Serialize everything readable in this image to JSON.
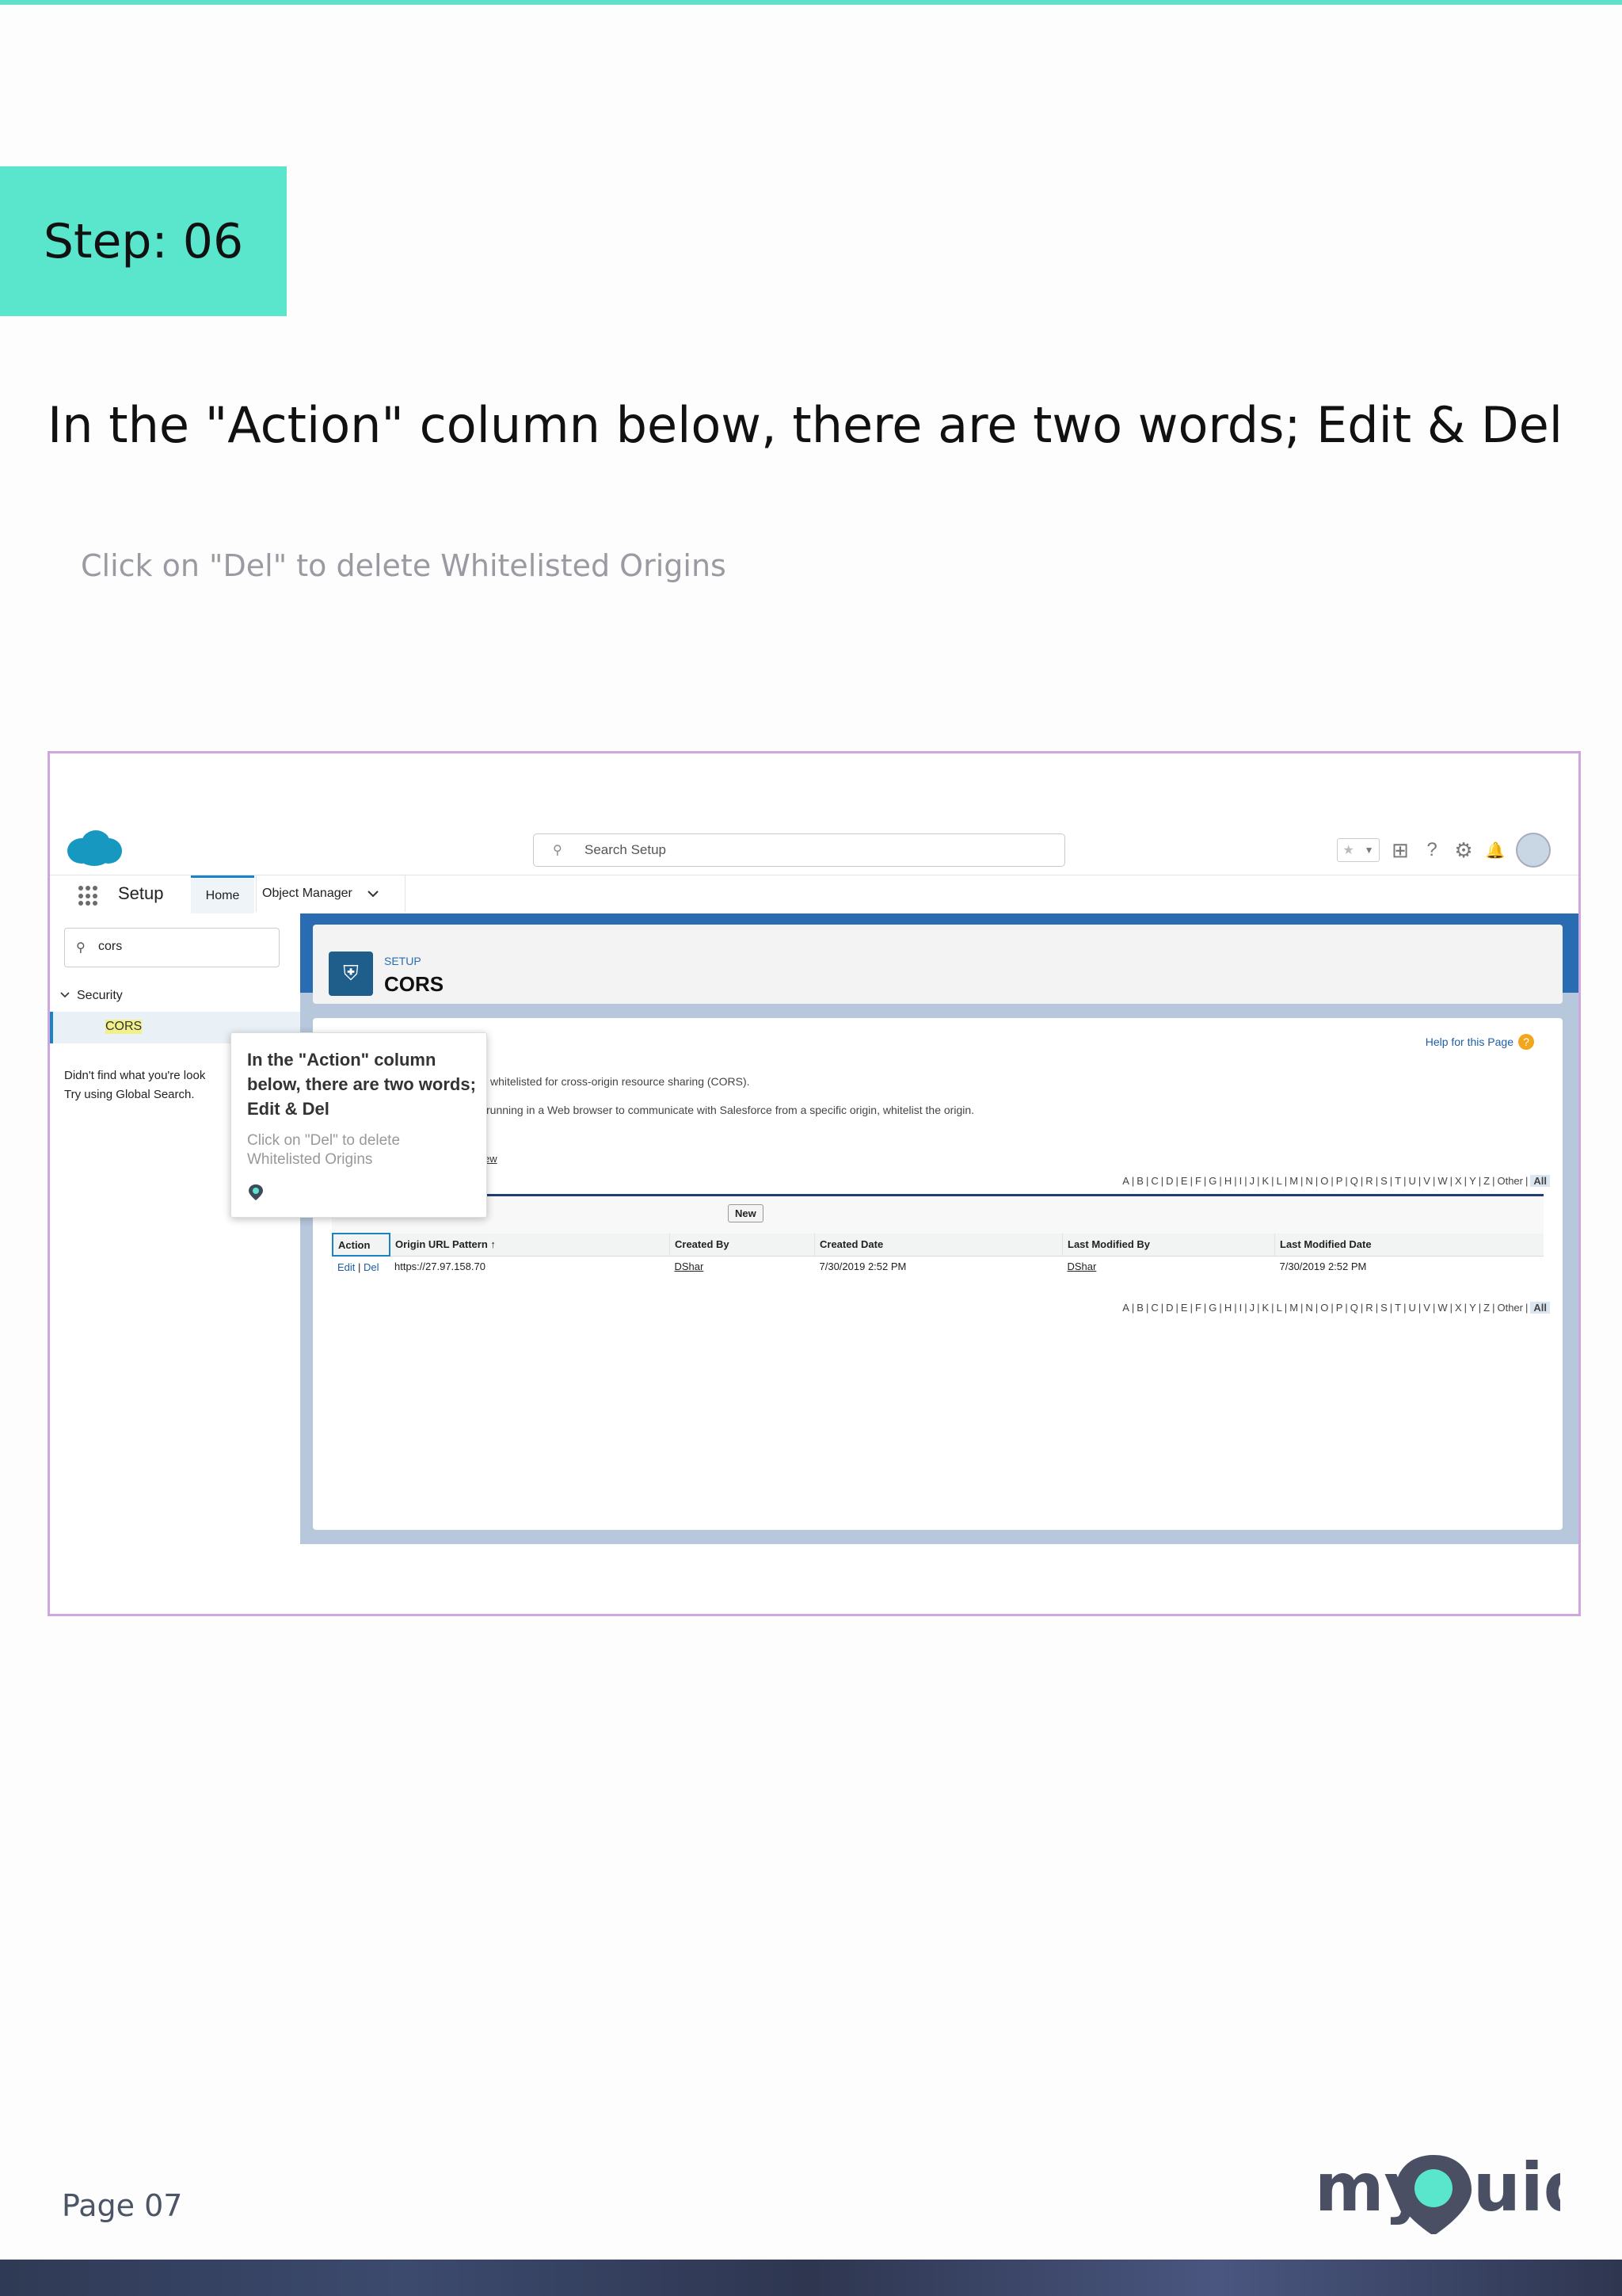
{
  "step": {
    "label": "Step: 06"
  },
  "instruction": {
    "title": "In the \"Action\" column below, there are two words; Edit & Del",
    "subtitle": "Click on \"Del\" to delete Whitelisted Origins"
  },
  "colors": {
    "accent": "#5ae6cd",
    "frame": "#cfa6e0",
    "sf_blue": "#2a6cb2"
  },
  "screenshot": {
    "header": {
      "search_placeholder": "Search Setup",
      "icons": [
        "favorites-star-icon",
        "add-icon",
        "help-icon",
        "settings-gear-icon",
        "notifications-bell-icon",
        "user-avatar"
      ]
    },
    "nav": {
      "app_name": "Setup",
      "tabs": [
        {
          "label": "Home"
        },
        {
          "label": "Object Manager"
        }
      ]
    },
    "sidebar": {
      "search_value": "cors",
      "section": "Security",
      "selected_item": "CORS",
      "help_line1": "Didn't find what you're look",
      "help_line2": "Try using Global Search."
    },
    "page_header": {
      "eyebrow": "SETUP",
      "title": "CORS"
    },
    "content": {
      "help_link": "Help for this Page",
      "desc1": "whitelisted for cross-origin resource sharing (CORS).",
      "desc2": "cript) running in a Web browser to communicate with Salesforce from a specific origin, whitelist the origin.",
      "view_link": "ew",
      "alphabet": [
        "A",
        "B",
        "C",
        "D",
        "E",
        "F",
        "G",
        "H",
        "I",
        "J",
        "K",
        "L",
        "M",
        "N",
        "O",
        "P",
        "Q",
        "R",
        "S",
        "T",
        "U",
        "V",
        "W",
        "X",
        "Y",
        "Z",
        "Other",
        "All"
      ],
      "new_button": "New",
      "table": {
        "columns": [
          "Action",
          "Origin URL Pattern ↑",
          "Created By",
          "Created Date",
          "Last Modified By",
          "Last Modified Date"
        ],
        "rows": [
          {
            "edit": "Edit",
            "sep": "|",
            "del": "Del",
            "origin": "https://27.97.158.70",
            "created_by": "DShar",
            "created_date": "7/30/2019 2:52 PM",
            "modified_by": "DShar",
            "modified_date": "7/30/2019 2:52 PM"
          }
        ]
      }
    },
    "tooltip": {
      "title": "In the \"Action\" column below, there are two words; Edit & Del",
      "desc": "Click on \"Del\" to delete Whitelisted Origins"
    }
  },
  "footer": {
    "page": "Page 07",
    "brand": "myGuide"
  }
}
